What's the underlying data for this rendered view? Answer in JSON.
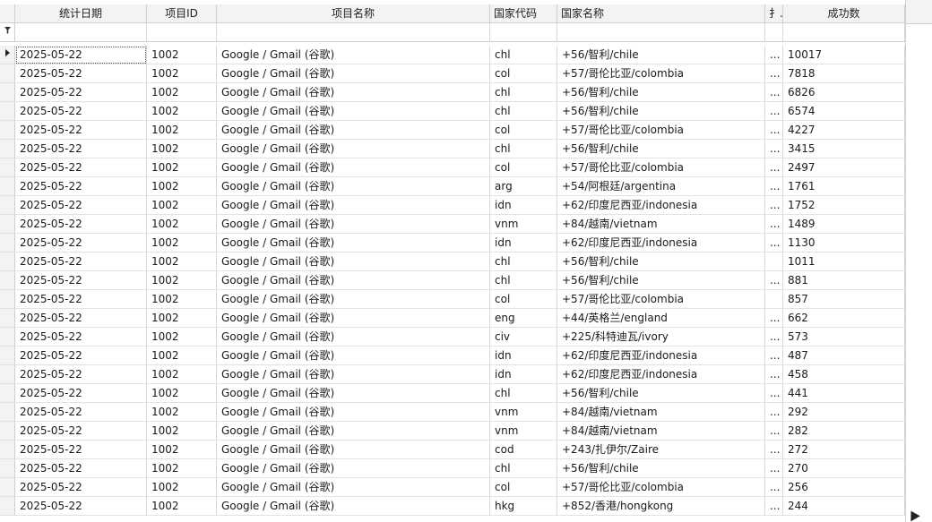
{
  "columns": [
    {
      "key": "date",
      "label": "统计日期"
    },
    {
      "key": "pid",
      "label": "项目ID"
    },
    {
      "key": "pname",
      "label": "项目名称"
    },
    {
      "key": "ccode",
      "label": "国家代码"
    },
    {
      "key": "cname",
      "label": "国家名称"
    },
    {
      "key": "extra",
      "label": "扌.."
    },
    {
      "key": "success",
      "label": "成功数"
    }
  ],
  "filter_row_icon": "filter-icon",
  "current_row_icon": "row-pointer-icon",
  "rows": [
    [
      "2025-05-22",
      "1002",
      "Google / Gmail (谷歌)",
      "chl",
      "+56/智利/chile",
      "...",
      "10017"
    ],
    [
      "2025-05-22",
      "1002",
      "Google / Gmail (谷歌)",
      "col",
      "+57/哥伦比亚/colombia",
      "...",
      "7818"
    ],
    [
      "2025-05-22",
      "1002",
      "Google / Gmail (谷歌)",
      "chl",
      "+56/智利/chile",
      "...",
      "6826"
    ],
    [
      "2025-05-22",
      "1002",
      "Google / Gmail (谷歌)",
      "chl",
      "+56/智利/chile",
      "...",
      "6574"
    ],
    [
      "2025-05-22",
      "1002",
      "Google / Gmail (谷歌)",
      "col",
      "+57/哥伦比亚/colombia",
      "...",
      "4227"
    ],
    [
      "2025-05-22",
      "1002",
      "Google / Gmail (谷歌)",
      "chl",
      "+56/智利/chile",
      "...",
      "3415"
    ],
    [
      "2025-05-22",
      "1002",
      "Google / Gmail (谷歌)",
      "col",
      "+57/哥伦比亚/colombia",
      "...",
      "2497"
    ],
    [
      "2025-05-22",
      "1002",
      "Google / Gmail (谷歌)",
      "arg",
      "+54/阿根廷/argentina",
      "...",
      "1761"
    ],
    [
      "2025-05-22",
      "1002",
      "Google / Gmail (谷歌)",
      "idn",
      "+62/印度尼西亚/indonesia",
      "...",
      "1752"
    ],
    [
      "2025-05-22",
      "1002",
      "Google / Gmail (谷歌)",
      "vnm",
      "+84/越南/vietnam",
      "...",
      "1489"
    ],
    [
      "2025-05-22",
      "1002",
      "Google / Gmail (谷歌)",
      "idn",
      "+62/印度尼西亚/indonesia",
      "...",
      "1130"
    ],
    [
      "2025-05-22",
      "1002",
      "Google / Gmail (谷歌)",
      "chl",
      "+56/智利/chile",
      "",
      "1011"
    ],
    [
      "2025-05-22",
      "1002",
      "Google / Gmail (谷歌)",
      "chl",
      "+56/智利/chile",
      "...",
      "881"
    ],
    [
      "2025-05-22",
      "1002",
      "Google / Gmail (谷歌)",
      "col",
      "+57/哥伦比亚/colombia",
      "",
      "857"
    ],
    [
      "2025-05-22",
      "1002",
      "Google / Gmail (谷歌)",
      "eng",
      "+44/英格兰/england",
      "...",
      "662"
    ],
    [
      "2025-05-22",
      "1002",
      "Google / Gmail (谷歌)",
      "civ",
      "+225/科特迪瓦/ivory",
      "...",
      "573"
    ],
    [
      "2025-05-22",
      "1002",
      "Google / Gmail (谷歌)",
      "idn",
      "+62/印度尼西亚/indonesia",
      "...",
      "487"
    ],
    [
      "2025-05-22",
      "1002",
      "Google / Gmail (谷歌)",
      "idn",
      "+62/印度尼西亚/indonesia",
      "...",
      "458"
    ],
    [
      "2025-05-22",
      "1002",
      "Google / Gmail (谷歌)",
      "chl",
      "+56/智利/chile",
      "...",
      "441"
    ],
    [
      "2025-05-22",
      "1002",
      "Google / Gmail (谷歌)",
      "vnm",
      "+84/越南/vietnam",
      "...",
      "292"
    ],
    [
      "2025-05-22",
      "1002",
      "Google / Gmail (谷歌)",
      "vnm",
      "+84/越南/vietnam",
      "...",
      "282"
    ],
    [
      "2025-05-22",
      "1002",
      "Google / Gmail (谷歌)",
      "cod",
      "+243/扎伊尔/Zaire",
      "...",
      "272"
    ],
    [
      "2025-05-22",
      "1002",
      "Google / Gmail (谷歌)",
      "chl",
      "+56/智利/chile",
      "...",
      "270"
    ],
    [
      "2025-05-22",
      "1002",
      "Google / Gmail (谷歌)",
      "col",
      "+57/哥伦比亚/colombia",
      "...",
      "256"
    ],
    [
      "2025-05-22",
      "1002",
      "Google / Gmail (谷歌)",
      "hkg",
      "+852/香港/hongkong",
      "...",
      "244"
    ]
  ]
}
